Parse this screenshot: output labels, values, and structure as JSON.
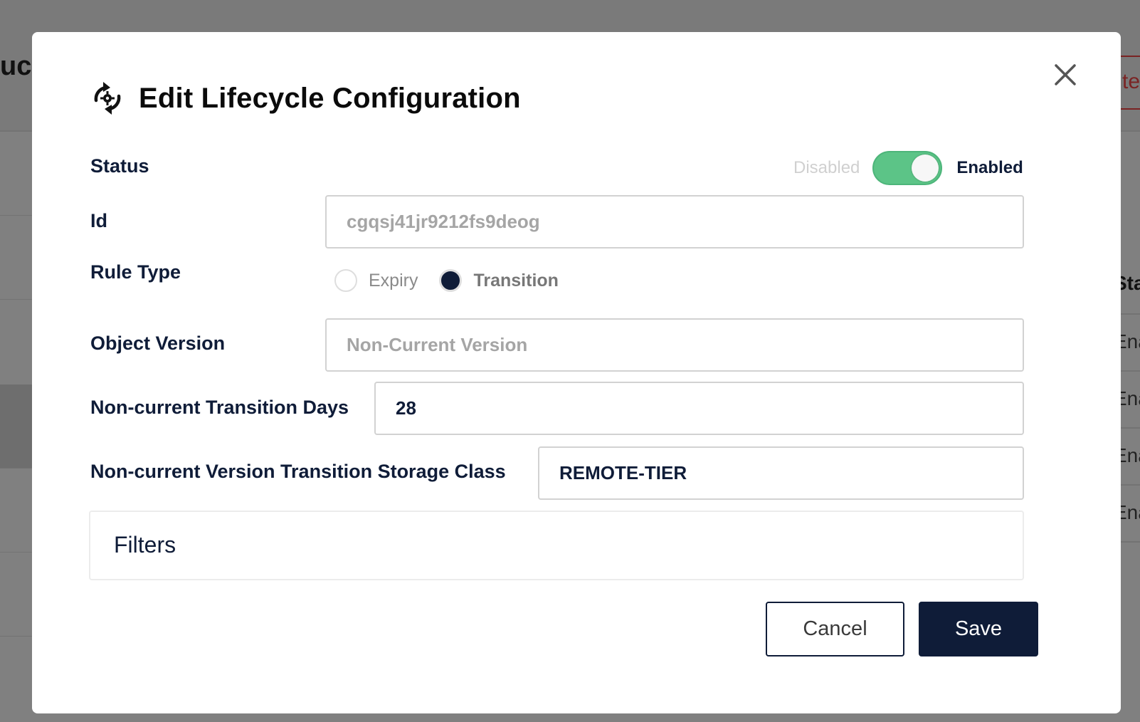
{
  "background": {
    "page_title_fragment": "uc",
    "header_button_fragment": "te",
    "column_header_fragment": "Sta",
    "cells": [
      "Ena",
      "Ena",
      "Ena",
      "Ena"
    ]
  },
  "modal": {
    "title": "Edit Lifecycle Configuration",
    "title_icon": "lifecycle-icon",
    "close_icon": "close-icon"
  },
  "form": {
    "status": {
      "label": "Status",
      "off_label": "Disabled",
      "on_label": "Enabled",
      "enabled": true
    },
    "id": {
      "label": "Id",
      "value": "cgqsj41jr9212fs9deog"
    },
    "rule_type": {
      "label": "Rule Type",
      "options": [
        "Expiry",
        "Transition"
      ],
      "selected": "Transition"
    },
    "object_version": {
      "label": "Object Version",
      "value": "Non-Current Version"
    },
    "noncurrent_days": {
      "label": "Non-current Transition Days",
      "value": "28"
    },
    "storage_class": {
      "label": "Non-current Version Transition Storage Class",
      "value": "REMOTE-TIER"
    },
    "filters": {
      "label": "Filters"
    }
  },
  "actions": {
    "cancel_label": "Cancel",
    "save_label": "Save"
  },
  "colors": {
    "primary": "#0f1c38",
    "toggle_on": "#5cc487",
    "danger": "#7a2323"
  }
}
